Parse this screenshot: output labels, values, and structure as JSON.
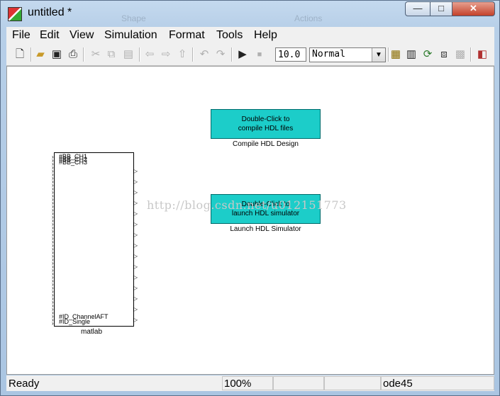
{
  "window": {
    "title": "untitled *",
    "controls": {
      "minimize": "—",
      "maximize": "□",
      "close": "✕"
    },
    "background_hints": [
      "Shape",
      "Actions"
    ]
  },
  "menu": [
    "File",
    "Edit",
    "View",
    "Simulation",
    "Format",
    "Tools",
    "Help"
  ],
  "toolbar": {
    "icons": [
      "new-file-icon",
      "open-folder-icon",
      "save-icon",
      "print-icon",
      "cut-icon",
      "copy-icon",
      "paste-icon",
      "back-arrow-icon",
      "forward-arrow-icon",
      "up-arrow-icon",
      "undo-icon",
      "redo-icon",
      "play-icon",
      "stop-icon",
      "library-browser-icon",
      "model-explorer-icon",
      "update-diagram-icon",
      "build-icon",
      "debug-icon",
      "model-advisor-icon"
    ],
    "stop_time": "10.0",
    "sim_mode": "Normal"
  },
  "canvas": {
    "compile_block": {
      "line1": "Double-Click to",
      "line2": "compile HDL files",
      "label": "Compile HDL Design"
    },
    "launch_block": {
      "line1": "Double-Click to",
      "line2": "launch HDL simulator",
      "label": "Launch HDL Simulator"
    },
    "matlab_block": {
      "label": "matlab",
      "top_ports": [
        "#BB_CH1",
        "#BB_CH2",
        "#BB_CH3"
      ],
      "bottom_ports": [
        "#ID_ChannelAFT",
        "#ID_Single"
      ]
    },
    "watermark": "http://blog.csdn.net/u012151773"
  },
  "status": {
    "ready": "Ready",
    "zoom": "100%",
    "solver": "ode45"
  },
  "colors": {
    "block_fill": "#1ccdc9",
    "accent": "#1ccdc9"
  }
}
